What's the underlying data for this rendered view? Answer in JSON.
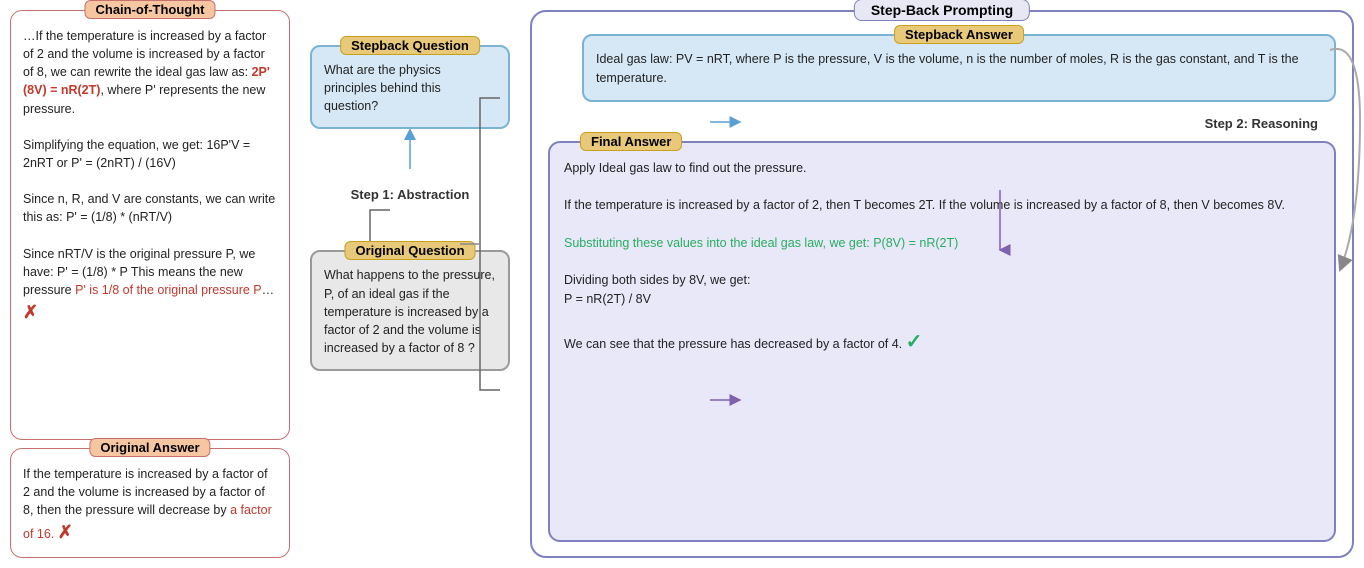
{
  "left": {
    "cot_title": "Chain-of-Thought",
    "cot_paragraph1": "…If the temperature is increased by a factor of 2 and the volume is increased by a factor of 8, we can rewrite the ideal gas law as: ",
    "cot_red1": "2P' (8V) = nR(2T)",
    "cot_paragraph1b": ", where P' represents the new pressure.",
    "cot_paragraph2": "Simplifying the equation, we get: 16P'V = 2nRT or P' = (2nRT) / (16V)",
    "cot_paragraph3": "Since n, R, and V are constants, we can write this as: P' = (1/8) * (nRT/V)",
    "cot_paragraph4": "Since nRT/V is the original pressure P, we have: P' = (1/8) * P This means the new pressure ",
    "cot_red2": "P' is 1/8 of the original pressure P",
    "cot_paragraph4b": "…",
    "x_mark": "✗",
    "orig_answer_title": "Original Answer",
    "orig_answer_text": "If the temperature is increased by a factor of 2 and the volume is increased by a factor of 8, then the pressure will decrease by ",
    "orig_answer_red": "a factor of 16.",
    "orig_answer_x": "✗"
  },
  "middle": {
    "step1_label": "Step 1: Abstraction",
    "stepback_q_title": "Stepback Question",
    "stepback_q_text": "What are the physics principles behind this question?",
    "original_q_title": "Original Question",
    "original_q_text": "What happens to the pressure, P, of an ideal gas if the temperature is increased by a factor of 2 and the volume is increased by a factor of 8 ?"
  },
  "right": {
    "main_title": "Step-Back Prompting",
    "stepback_ans_title": "Stepback Answer",
    "stepback_ans_text": "Ideal gas law: PV = nRT, where P is the pressure, V is the volume, n is the number of moles, R is the gas constant, and T is the temperature.",
    "step2_label": "Step 2: Reasoning",
    "final_ans_title": "Final Answer",
    "final_ans_para1": "Apply Ideal gas law to find out the pressure.",
    "final_ans_para2": "If the temperature is increased by a factor of 2, then T becomes 2T. If the volume is increased by a factor of 8, then V becomes 8V.",
    "final_ans_green": "Substituting these values into the ideal gas law, we get: P(8V) = nR(2T)",
    "final_ans_para3": "Dividing both sides by 8V, we get:\nP = nR(2T) / 8V",
    "final_ans_para4": "We can see that the pressure has decreased by a factor of 4.",
    "check_mark": "✓"
  }
}
